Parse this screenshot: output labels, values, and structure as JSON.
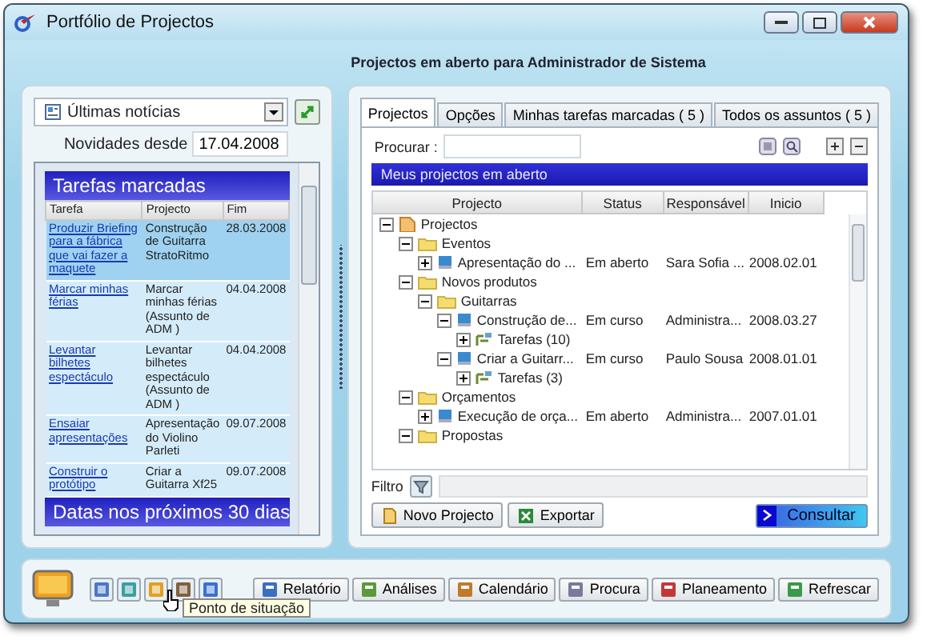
{
  "window": {
    "title": "Portfólio de Projectos"
  },
  "header": {
    "title": "Projectos em aberto para Administrador de Sistema"
  },
  "news": {
    "source": "Últimas notícias",
    "since_label": "Novidades desde",
    "since_value": "17.04.2008",
    "sections": [
      {
        "title": "Tarefas marcadas",
        "columns": [
          "Tarefa",
          "Projecto",
          "Fim"
        ],
        "rows": [
          {
            "task": "Produzir Briefing para a fábrica que vai fazer a maquete",
            "project": "Construção de Guitarra StratoRitmo",
            "end": "28.03.2008",
            "selected": true
          },
          {
            "task": "Marcar minhas férias",
            "project": "Marcar minhas férias (Assunto de ADM )",
            "end": "04.04.2008",
            "selected": false
          },
          {
            "task": "Levantar bilhetes espectáculo",
            "project": "Levantar bilhetes espectáculo (Assunto de ADM )",
            "end": "04.04.2008",
            "selected": false
          },
          {
            "task": "Ensaiar apresentações",
            "project": "Apresentação do Violino Parleti",
            "end": "09.07.2008",
            "selected": false
          },
          {
            "task": "Construir o protótipo",
            "project": "Criar a Guitarra Xf25",
            "end": "09.07.2008",
            "selected": false
          }
        ]
      },
      {
        "title": "Datas nos próximos 30 dias"
      }
    ]
  },
  "projects": {
    "tabs": [
      {
        "label": "Projectos",
        "selected": true
      },
      {
        "label": "Opções",
        "selected": false
      },
      {
        "label": "Minhas tarefas marcadas ( 5 )",
        "selected": false
      },
      {
        "label": "Todos os assuntos ( 5 )",
        "selected": false
      }
    ],
    "search_label": "Procurar :",
    "panel_title": "Meus projectos em aberto",
    "columns": [
      "Projecto",
      "Status",
      "Responsável",
      "Inicio"
    ],
    "tree": [
      {
        "label": "Projectos",
        "kind": "root",
        "expanded": true,
        "children": [
          {
            "label": "Eventos",
            "kind": "folder",
            "expanded": true,
            "children": [
              {
                "label": "Apresentação do ...",
                "kind": "project",
                "expanded": false,
                "status": "Em aberto",
                "owner": "Sara Sofia ...",
                "start": "2008.02.01"
              }
            ]
          },
          {
            "label": "Novos produtos",
            "kind": "folder",
            "expanded": true,
            "children": [
              {
                "label": "Guitarras",
                "kind": "folder",
                "expanded": true,
                "children": [
                  {
                    "label": "Construção de...",
                    "kind": "project",
                    "expanded": true,
                    "status": "Em curso",
                    "owner": "Administra...",
                    "start": "2008.03.27",
                    "children": [
                      {
                        "label": "Tarefas (10)",
                        "kind": "tasks",
                        "expanded": false
                      }
                    ]
                  },
                  {
                    "label": "Criar a Guitarr...",
                    "kind": "project",
                    "expanded": true,
                    "status": "Em curso",
                    "owner": "Paulo Sousa",
                    "start": "2008.01.01",
                    "children": [
                      {
                        "label": "Tarefas (3)",
                        "kind": "tasks",
                        "expanded": false
                      }
                    ]
                  }
                ]
              }
            ]
          },
          {
            "label": "Orçamentos",
            "kind": "folder",
            "expanded": true,
            "children": [
              {
                "label": "Execução de orça...",
                "kind": "project",
                "expanded": false,
                "status": "Em aberto",
                "owner": "Administra...",
                "start": "2007.01.01"
              }
            ]
          },
          {
            "label": "Propostas",
            "kind": "folder",
            "expanded": true
          }
        ]
      }
    ],
    "filter_label": "Filtro",
    "buttons": [
      "Novo Projecto",
      "Exportar"
    ],
    "query_button": "Consultar"
  },
  "toolbar": {
    "tooltip": "Ponto de situação",
    "buttons": [
      "Relatório",
      "Análises",
      "Calendário",
      "Procura",
      "Planeamento",
      "Refrescar"
    ]
  }
}
